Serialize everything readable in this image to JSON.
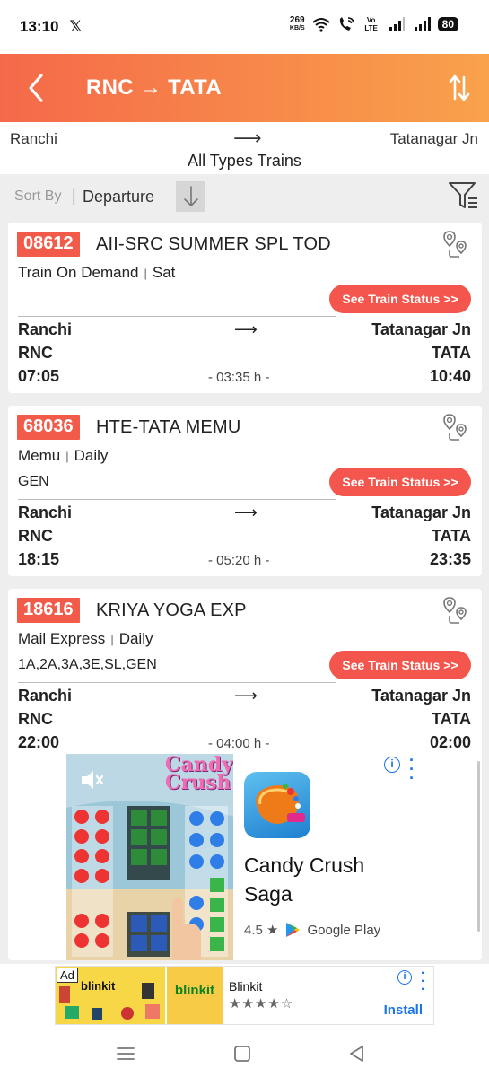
{
  "status_bar": {
    "time": "13:10",
    "x_logo": "𝕏",
    "net_speed_value": "269",
    "net_speed_unit": "KB/S",
    "volte": "Vo LTE",
    "battery": "80"
  },
  "header": {
    "route_title": "RNC → TATA",
    "back_icon": "chevron-left-icon",
    "swap_icon": "swap-vertical-icon"
  },
  "route": {
    "from": "Ranchi",
    "arrow": "⟶",
    "to": "Tatanagar Jn",
    "train_types": "All Types Trains"
  },
  "sort": {
    "label": "Sort By",
    "separator": "|",
    "value": "Departure",
    "direction_icon": "arrow-down-icon",
    "filter_icon": "filter-icon"
  },
  "trains": [
    {
      "number": "08612",
      "name": "AII-SRC SUMMER SPL TOD",
      "type": "Train On Demand",
      "days": "Sat",
      "classes": "",
      "status_button": "See Train Status  >>",
      "from_name": "Ranchi",
      "to_name": "Tatanagar Jn",
      "from_code": "RNC",
      "to_code": "TATA",
      "dep_time": "07:05",
      "arr_time": "10:40",
      "duration": "- 03:35 h -",
      "arrow": "⟶"
    },
    {
      "number": "68036",
      "name": "HTE-TATA MEMU",
      "type": "Memu",
      "days": "Daily",
      "classes": "GEN",
      "status_button": "See Train Status  >>",
      "from_name": "Ranchi",
      "to_name": "Tatanagar Jn",
      "from_code": "RNC",
      "to_code": "TATA",
      "dep_time": "18:15",
      "arr_time": "23:35",
      "duration": "- 05:20 h -",
      "arrow": "⟶"
    },
    {
      "number": "18616",
      "name": "KRIYA YOGA EXP",
      "type": "Mail Express",
      "days": "Daily",
      "classes": "1A,2A,3A,3E,SL,GEN",
      "status_button": "See Train Status  >>",
      "from_name": "Ranchi",
      "to_name": "Tatanagar Jn",
      "from_code": "RNC",
      "to_code": "TATA",
      "dep_time": "22:00",
      "arr_time": "02:00",
      "duration": "- 04:00 h -",
      "arrow": "⟶"
    }
  ],
  "native_ad": {
    "game_logo_line1": "Candy",
    "game_logo_line2": "Crush",
    "title": "Candy Crush Saga",
    "rating": "4.5 ★",
    "store": "Google Play",
    "info": "i"
  },
  "banner_ad": {
    "badge": "Ad",
    "brand_word": "blinkit",
    "name": "Blinkit",
    "stars": "★★★★☆",
    "install": "Install",
    "info": "i"
  },
  "colors": {
    "header_start": "#f5694a",
    "header_end": "#f9a24b",
    "train_number_bg": "#f25a4a",
    "status_button_bg": "#f4554c",
    "link_blue": "#1a73e8"
  }
}
